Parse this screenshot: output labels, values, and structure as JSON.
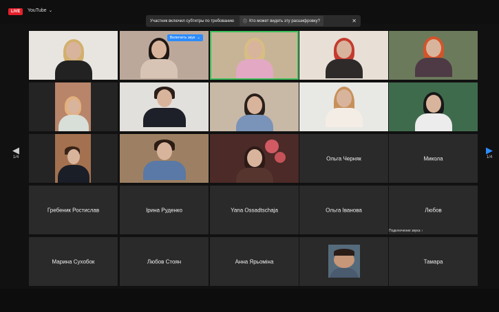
{
  "topbar": {
    "live_label": "LIVE",
    "source_label": "YouTube",
    "caption_banner": "Участник включил субтитры по требованию",
    "caption_link": "Кто может видеть эту расшифровку?",
    "close_symbol": "✕"
  },
  "navigation": {
    "left_page": "1/4",
    "right_page": "1/4"
  },
  "tiles": {
    "r1c2_button": "Включить звук",
    "r3c4": "Ольга Черняк",
    "r3c5": "Микола",
    "r4c1": "Гребеник Ростислав",
    "r4c2": "Ірина Руденко",
    "r4c3": "Yana Ossadtschaja",
    "r4c4": "Ольга Іванова",
    "r4c5": "Любов",
    "r5c1": "Марина Сухобок",
    "r5c2": "Любов Стоян",
    "r5c3": "Анна Ярьоміна",
    "r5c5": "Тамара"
  },
  "audio_tooltip": "Подключение звука",
  "colors": {
    "accent_blue": "#2d8cff",
    "live_red": "#e5202b",
    "active_speaker": "#3bbf5a",
    "tile_bg": "#2a2a2a"
  },
  "icons": [
    "caption-info-icon",
    "chevron-down-icon",
    "close-icon",
    "chevron-left-icon",
    "chevron-right-icon"
  ]
}
